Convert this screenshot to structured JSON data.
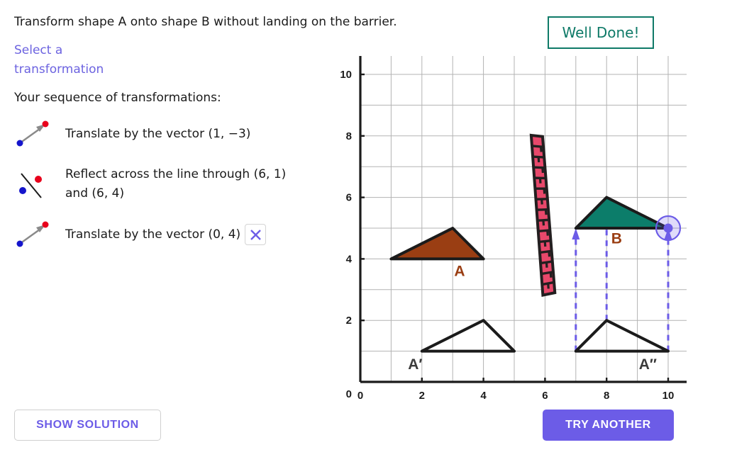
{
  "prompt": "Transform shape A onto shape B without landing on the barrier.",
  "select_transformation_label": "Select a transformation",
  "sequence_label": "Your sequence of transformations:",
  "badge": {
    "text": "Well Done!"
  },
  "buttons": {
    "show_solution": "SHOW SOLUTION",
    "try_another": "TRY ANOTHER"
  },
  "sequence": [
    {
      "icon": "translate-vector-icon",
      "text": "Translate by the vector (1, −3)",
      "deletable": false
    },
    {
      "icon": "reflect-line-icon",
      "text": "Reflect across the line through (6, 1) and (6, 4)",
      "deletable": false
    },
    {
      "icon": "translate-vector-icon",
      "text": "Translate by the vector (0, 4)",
      "deletable": true,
      "delete_label": "✕"
    }
  ],
  "chart_data": {
    "type": "scatter",
    "title": "",
    "xlabel": "",
    "ylabel": "",
    "xlim": [
      0,
      10.6
    ],
    "ylim": [
      0,
      10.6
    ],
    "grid": true,
    "x_ticks": [
      0,
      2,
      4,
      6,
      8,
      10
    ],
    "y_ticks": [
      0,
      2,
      4,
      6,
      8,
      10
    ],
    "minor_grid_step": 1,
    "colors": {
      "shape_a_fill": "#9a3e13",
      "shape_a_stroke": "#1b1b1b",
      "shape_b_fill": "#0c7d6a",
      "shape_b_stroke": "#1b1b1b",
      "image_stroke": "#1b1b1b",
      "barrier_fill": "#e8486b",
      "barrier_stroke": "#231f20",
      "vector_arrow": "#6c5ce7",
      "handle": "#6c5ce7",
      "grid": "#b3b3b3",
      "axis": "#1b1b1b"
    },
    "shapes": [
      {
        "name": "A",
        "label": "A",
        "label_pos": [
          3.05,
          3.45
        ],
        "label_color": "#9a3e13",
        "points": [
          [
            1,
            4
          ],
          [
            3,
            5
          ],
          [
            4,
            4
          ]
        ],
        "fill": "#9a3e13",
        "stroke": "#1b1b1b"
      },
      {
        "name": "B",
        "label": "B",
        "label_pos": [
          8.15,
          4.5
        ],
        "label_color": "#9a3e13",
        "points": [
          [
            7,
            5
          ],
          [
            8,
            6
          ],
          [
            10,
            5
          ]
        ],
        "fill": "#0c7d6a",
        "stroke": "#1b1b1b"
      },
      {
        "name": "A-prime",
        "label": "A′",
        "label_pos": [
          1.55,
          0.42
        ],
        "label_color": "#3b3b3b",
        "points": [
          [
            2,
            1
          ],
          [
            4,
            2
          ],
          [
            5,
            1
          ]
        ],
        "fill": "none",
        "stroke": "#1b1b1b"
      },
      {
        "name": "A-double-prime",
        "label": "A″",
        "label_pos": [
          9.05,
          0.42
        ],
        "label_color": "#3b3b3b",
        "points": [
          [
            7,
            1
          ],
          [
            8,
            2
          ],
          [
            10,
            1
          ]
        ],
        "fill": "none",
        "stroke": "#1b1b1b"
      }
    ],
    "barrier": {
      "name": "brick-barrier",
      "corners": [
        [
          5.55,
          8.02
        ],
        [
          5.92,
          7.98
        ],
        [
          6.32,
          2.9
        ],
        [
          5.93,
          2.82
        ]
      ],
      "fill": "#e8486b",
      "stroke": "#231f20"
    },
    "translation_arrows": [
      {
        "from": [
          7,
          1
        ],
        "to": [
          7,
          5
        ]
      },
      {
        "from": [
          8,
          2
        ],
        "to": [
          8,
          6
        ]
      },
      {
        "from": [
          10,
          1
        ],
        "to": [
          10,
          5
        ]
      }
    ],
    "handle": {
      "at": [
        10,
        5
      ],
      "color": "#6c5ce7"
    }
  }
}
